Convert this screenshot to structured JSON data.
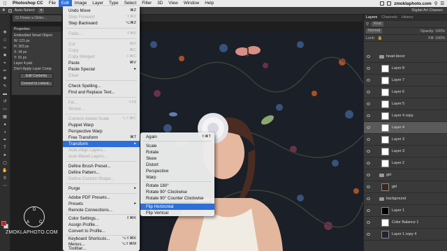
{
  "menubar": {
    "app": "Photoshop CC",
    "items": [
      "File",
      "Edit",
      "Image",
      "Layer",
      "Type",
      "Select",
      "Filter",
      "3D",
      "View",
      "Window",
      "Help"
    ],
    "active": "Edit",
    "site": "zmoklaphoto.com"
  },
  "options": {
    "auto_select": "Auto-Select:",
    "workspace": "Digital Art Classes"
  },
  "document": {
    "tab": "Cr Flower a Glitter..."
  },
  "properties": {
    "title": "Properties",
    "type": "Embedded Smart Object",
    "w": "W: 121 px",
    "h": "H: 303 px",
    "x": "X: 34 px",
    "y": "Y: 91 px",
    "layer": "Layer 4.psb",
    "apply": "Don't Apply Layer Comp",
    "edit_btn": "Edit Contents",
    "convert_btn": "Convert to Linked..."
  },
  "edit_menu": {
    "items": [
      {
        "label": "Undo Move",
        "sc": "⌘Z",
        "dis": false
      },
      {
        "label": "Step Forward",
        "sc": "⇧⌘Z",
        "dis": true
      },
      {
        "label": "Step Backward",
        "sc": "⌥⌘Z",
        "dis": false
      },
      {
        "label": "Fade...",
        "sc": "⇧⌘F",
        "dis": true
      },
      {
        "label": "Cut",
        "sc": "⌘X",
        "dis": true
      },
      {
        "label": "Copy",
        "sc": "⌘C",
        "dis": true
      },
      {
        "label": "Copy Merged",
        "sc": "⇧⌘C",
        "dis": true
      },
      {
        "label": "Paste",
        "sc": "⌘V",
        "dis": false
      },
      {
        "label": "Paste Special",
        "sc": "▸",
        "dis": false
      },
      {
        "label": "Clear",
        "sc": "",
        "dis": true
      },
      {
        "label": "Check Spelling...",
        "sc": "",
        "dis": false
      },
      {
        "label": "Find and Replace Text...",
        "sc": "",
        "dis": false
      },
      {
        "label": "Fill...",
        "sc": "⇧F5",
        "dis": true
      },
      {
        "label": "Stroke...",
        "sc": "",
        "dis": true
      },
      {
        "label": "Content-Aware Scale",
        "sc": "⌥⇧⌘C",
        "dis": true
      },
      {
        "label": "Puppet Warp",
        "sc": "",
        "dis": false
      },
      {
        "label": "Perspective Warp",
        "sc": "",
        "dis": false
      },
      {
        "label": "Free Transform",
        "sc": "⌘T",
        "dis": false
      },
      {
        "label": "Transform",
        "sc": "▸",
        "dis": false,
        "hl": true
      },
      {
        "label": "Auto-Align Layers...",
        "sc": "",
        "dis": true
      },
      {
        "label": "Auto-Blend Layers...",
        "sc": "",
        "dis": true
      },
      {
        "label": "Define Brush Preset...",
        "sc": "",
        "dis": false
      },
      {
        "label": "Define Pattern...",
        "sc": "",
        "dis": false
      },
      {
        "label": "Define Custom Shape...",
        "sc": "",
        "dis": true
      },
      {
        "label": "Purge",
        "sc": "▸",
        "dis": false
      },
      {
        "label": "Adobe PDF Presets...",
        "sc": "",
        "dis": false
      },
      {
        "label": "Presets",
        "sc": "▸",
        "dis": false
      },
      {
        "label": "Remote Connections...",
        "sc": "",
        "dis": false
      },
      {
        "label": "Color Settings...",
        "sc": "⇧⌘K",
        "dis": false
      },
      {
        "label": "Assign Profile...",
        "sc": "",
        "dis": false
      },
      {
        "label": "Convert to Profile...",
        "sc": "",
        "dis": false
      },
      {
        "label": "Keyboard Shortcuts...",
        "sc": "⌥⇧⌘K",
        "dis": false
      },
      {
        "label": "Menus...",
        "sc": "⌥⇧⌘M",
        "dis": false
      },
      {
        "label": "Toolbar...",
        "sc": "",
        "dis": false
      }
    ]
  },
  "transform_menu": {
    "items": [
      {
        "label": "Again",
        "sc": "⇧⌘T"
      },
      {
        "label": "Scale",
        "sc": ""
      },
      {
        "label": "Rotate",
        "sc": ""
      },
      {
        "label": "Skew",
        "sc": ""
      },
      {
        "label": "Distort",
        "sc": ""
      },
      {
        "label": "Perspective",
        "sc": ""
      },
      {
        "label": "Warp",
        "sc": ""
      },
      {
        "label": "Rotate 180°",
        "sc": ""
      },
      {
        "label": "Rotate 90° Clockwise",
        "sc": ""
      },
      {
        "label": "Rotate 90° Counter Clockwise",
        "sc": ""
      },
      {
        "label": "Flip Horizontal",
        "sc": "",
        "hl": true
      },
      {
        "label": "Flip Vertical",
        "sc": ""
      }
    ]
  },
  "layers_panel": {
    "tabs": [
      "Layers",
      "Channels",
      "History"
    ],
    "kind": "Kind",
    "blend": "Normal",
    "opacity": "Opacity: 100%",
    "lock": "Lock:",
    "fill": "Fill: 100%",
    "rows": [
      {
        "name": "head decor",
        "group": true
      },
      {
        "name": "Layer 8",
        "thumb": "white"
      },
      {
        "name": "Layer 7",
        "thumb": "white"
      },
      {
        "name": "Layer 6",
        "thumb": "white"
      },
      {
        "name": "Layer 5",
        "thumb": "white"
      },
      {
        "name": "Layer 4 copy",
        "thumb": "white"
      },
      {
        "name": "Layer 4",
        "thumb": "white",
        "sel": true
      },
      {
        "name": "Layer 3",
        "thumb": "white"
      },
      {
        "name": "Layer 3",
        "thumb": "white"
      },
      {
        "name": "Layer 2",
        "thumb": "white"
      },
      {
        "name": "girl",
        "group": true
      },
      {
        "name": "girl",
        "thumb": "girl"
      },
      {
        "name": "background",
        "group": true
      },
      {
        "name": "Layer 1",
        "thumb": "black"
      },
      {
        "name": "Color Balance 1",
        "thumb": "white"
      },
      {
        "name": "Layer 1 copy 4",
        "thumb": "dark"
      }
    ]
  },
  "watermark": {
    "letters": [
      "D",
      "A",
      "C"
    ],
    "url": "ZMOKLAPHOTO.COM"
  }
}
